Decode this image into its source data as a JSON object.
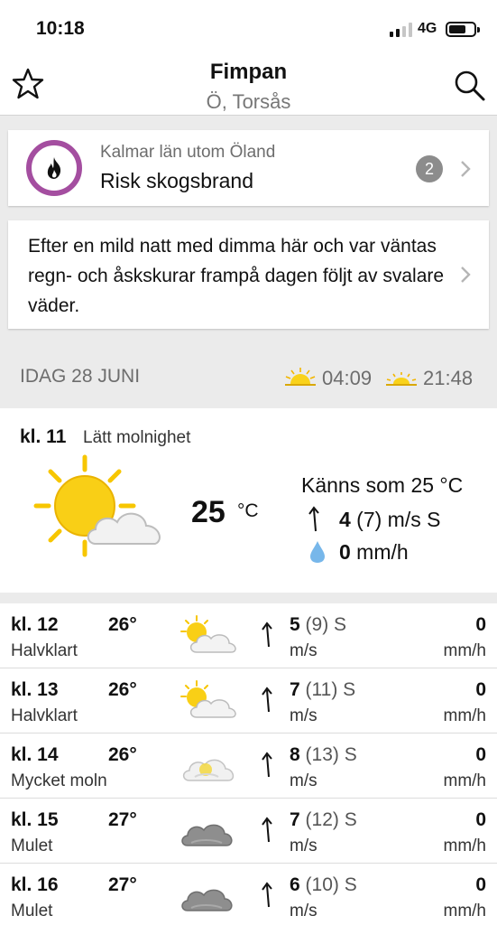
{
  "status": {
    "time": "10:18",
    "network": "4G"
  },
  "header": {
    "title": "Fimpan",
    "subtitle": "Ö, Torsås",
    "favorite_icon": "star-icon",
    "search_icon": "search-icon"
  },
  "warning": {
    "region": "Kalmar län utom Öland",
    "title": "Risk skogsbrand",
    "count": "2",
    "icon": "fire-icon",
    "accent": "#a44ea0"
  },
  "summary": {
    "text": "Efter en mild natt med dimma här och var väntas regn- och åskskurar frampå dagen följt av svalare väder."
  },
  "day": {
    "label": "IDAG 28 JUNI",
    "sunrise": "04:09",
    "sunset": "21:48"
  },
  "current": {
    "hour": "kl. 11",
    "condition": "Lätt molnighet",
    "icon": "sun-cloud-icon",
    "temp": "25",
    "unit": "°C",
    "feels_like": "Känns som 25 °C",
    "wind": "4",
    "wind_rest": " (7) m/s S",
    "precip": "0",
    "precip_unit": " mm/h"
  },
  "hourly": [
    {
      "hour": "kl. 12",
      "condition": "Halvklart",
      "temp": "26°",
      "icon": "partly-sunny-icon",
      "wind": "5",
      "gust": " (9) S",
      "wind_unit": "m/s",
      "precip": "0",
      "precip_unit": "mm/h"
    },
    {
      "hour": "kl. 13",
      "condition": "Halvklart",
      "temp": "26°",
      "icon": "partly-sunny-icon",
      "wind": "7",
      "gust": " (11) S",
      "wind_unit": "m/s",
      "precip": "0",
      "precip_unit": "mm/h"
    },
    {
      "hour": "kl. 14",
      "condition": "Mycket moln",
      "temp": "26°",
      "icon": "mostly-cloudy-icon",
      "wind": "8",
      "gust": " (13) S",
      "wind_unit": "m/s",
      "precip": "0",
      "precip_unit": "mm/h"
    },
    {
      "hour": "kl. 15",
      "condition": "Mulet",
      "temp": "27°",
      "icon": "overcast-icon",
      "wind": "7",
      "gust": " (12) S",
      "wind_unit": "m/s",
      "precip": "0",
      "precip_unit": "mm/h"
    },
    {
      "hour": "kl. 16",
      "condition": "Mulet",
      "temp": "27°",
      "icon": "overcast-icon",
      "wind": "6",
      "gust": " (10) S",
      "wind_unit": "m/s",
      "precip": "0",
      "precip_unit": "mm/h"
    }
  ]
}
